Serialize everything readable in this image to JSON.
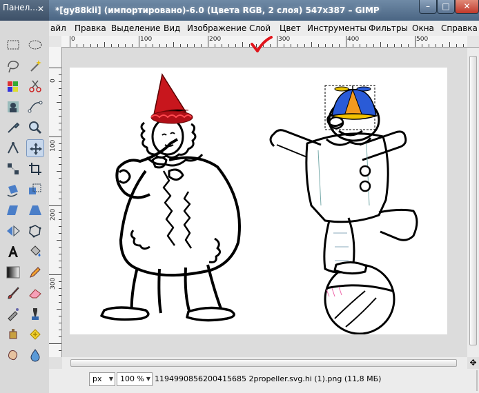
{
  "toolbox": {
    "title": "Панел...",
    "close_glyph": "✕",
    "tools": [
      {
        "name": "rect-select-icon"
      },
      {
        "name": "ellipse-select-icon"
      },
      {
        "name": "lasso-icon"
      },
      {
        "name": "fuzzy-select-icon"
      },
      {
        "name": "color-select-icon"
      },
      {
        "name": "scissors-icon"
      },
      {
        "name": "foreground-select-icon"
      },
      {
        "name": "paths-icon"
      },
      {
        "name": "color-picker-icon"
      },
      {
        "name": "zoom-icon"
      },
      {
        "name": "measure-icon"
      },
      {
        "name": "move-icon",
        "active": true
      },
      {
        "name": "align-icon"
      },
      {
        "name": "crop-icon"
      },
      {
        "name": "rotate-icon"
      },
      {
        "name": "scale-icon"
      },
      {
        "name": "shear-icon"
      },
      {
        "name": "perspective-icon"
      },
      {
        "name": "flip-icon"
      },
      {
        "name": "cage-icon"
      },
      {
        "name": "text-icon"
      },
      {
        "name": "bucket-fill-icon"
      },
      {
        "name": "blend-icon"
      },
      {
        "name": "pencil-icon"
      },
      {
        "name": "paintbrush-icon"
      },
      {
        "name": "eraser-icon"
      },
      {
        "name": "airbrush-icon"
      },
      {
        "name": "ink-icon"
      },
      {
        "name": "clone-icon"
      },
      {
        "name": "heal-icon"
      },
      {
        "name": "smudge-icon"
      },
      {
        "name": "dodge-burn-icon"
      }
    ]
  },
  "window": {
    "title": "*[gy88kii] (импортировано)-6.0 (Цвета RGB, 2 слоя) 547x387 – GIMP",
    "minimize_glyph": "–",
    "maximize_glyph": "□",
    "close_glyph": "✕"
  },
  "menubar": {
    "items": [
      {
        "label": "айл"
      },
      {
        "label": "Правка"
      },
      {
        "label": "Выделение"
      },
      {
        "label": "Вид"
      },
      {
        "label": "Изображение"
      },
      {
        "label": "Слой"
      },
      {
        "label": "Цвет"
      },
      {
        "label": "Инструменты"
      },
      {
        "label": "Фильтры"
      },
      {
        "label": "Окна"
      },
      {
        "label": "Справка"
      }
    ],
    "overflow_glyph": "▸"
  },
  "ruler": {
    "h_labels": [
      "0",
      "100",
      "200",
      "300",
      "400",
      "500"
    ],
    "v_labels": [
      "0",
      "100",
      "200",
      "300"
    ]
  },
  "statusbar": {
    "unit": "px",
    "zoom": "100 %",
    "file_info": "1194990856200415685 2propeller.svg.hi (1).png (11,8 МБ)"
  },
  "colors": {
    "titlebar": "#4a6583",
    "hat_red": "#c8161d",
    "cap_blue": "#2a5bd7",
    "cap_orange": "#f39a1e",
    "check_red": "#e0141b"
  }
}
